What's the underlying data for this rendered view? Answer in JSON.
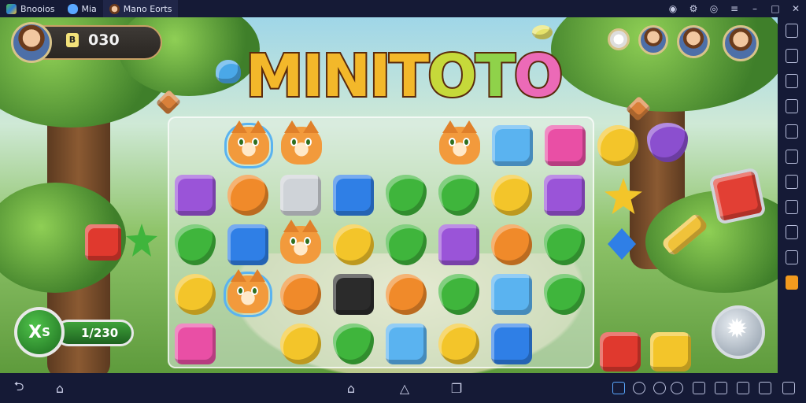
{
  "emulator": {
    "tabs": [
      {
        "label": "Bnooios",
        "icon": "emulator-logo-icon"
      },
      {
        "label": "Mia",
        "icon": "cloud-icon"
      },
      {
        "label": "Mano Eorts",
        "icon": "game-avatar-icon"
      }
    ],
    "window_controls": [
      "help-icon",
      "settings-icon",
      "gamepad-icon",
      "menu-icon",
      "minimize-icon",
      "maximize-icon",
      "close-icon"
    ],
    "sidebar_tools": [
      "keyboard-icon",
      "screenshot-icon",
      "camera-icon",
      "apk-icon",
      "folder-icon",
      "volume-icon",
      "rotate-icon",
      "shake-icon",
      "macro-icon",
      "location-icon",
      "more-icon"
    ],
    "bottom_nav": [
      "back-icon",
      "home-icon",
      "home-outline-icon",
      "recents-icon"
    ],
    "bottom_tools": [
      "keymap-icon",
      "gamepad-icon",
      "location-icon",
      "fullscreen-icon",
      "shuffle-icon",
      "resize-icon",
      "expand-icon"
    ],
    "accent": "#f29a1e"
  },
  "game": {
    "title": "MINITOTO",
    "title_colors": [
      "#f3b82a",
      "#f3b82a",
      "#f3b82a",
      "#f3b82a",
      "#f3b82a",
      "#c6d93a",
      "#8fd24a",
      "#ec6ab7"
    ],
    "score_badge": "B",
    "score": "030",
    "moves_icon": "X",
    "moves_suffix": "S",
    "moves_count": "1/230",
    "rivals": [
      "rival-avatar-1",
      "rival-avatar-2",
      "rival-avatar-3",
      "rival-avatar-4"
    ]
  }
}
